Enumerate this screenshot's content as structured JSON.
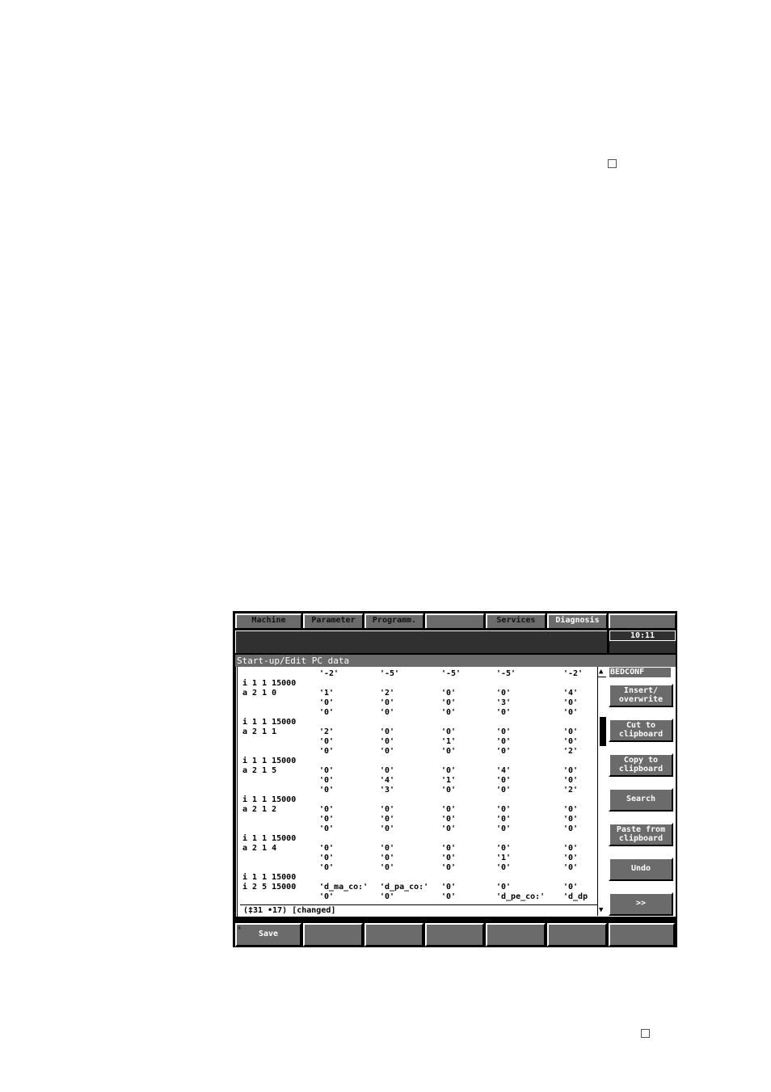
{
  "page_marks": [
    "small-square",
    "small-square"
  ],
  "tabs": [
    {
      "label": "Machine",
      "active": false
    },
    {
      "label": "Parameter",
      "active": false
    },
    {
      "label": "Programm.",
      "active": false
    },
    {
      "label": "",
      "active": false
    },
    {
      "label": "Services",
      "active": false
    },
    {
      "label": "Diagnosis",
      "active": true
    },
    {
      "label": "",
      "active": false
    }
  ],
  "clock": "10:11",
  "window_title": "Start-up/Edit PC data",
  "filename": "BEDCONF",
  "editor_lines": [
    {
      "label": "",
      "cells": [
        "'-2'",
        "'-5'",
        "'-5'",
        "'-5'",
        "'-2'"
      ]
    },
    {
      "label": "i 1 1 15000",
      "cells": []
    },
    {
      "label": "a 2 1 0",
      "cells": [
        "'1'",
        "'2'",
        "'0'",
        "'0'",
        "'4'"
      ]
    },
    {
      "label": "",
      "cells": [
        "'0'",
        "'0'",
        "'0'",
        "'3'",
        "'0'"
      ]
    },
    {
      "label": "",
      "cells": [
        "'0'",
        "'0'",
        "'0'",
        "'0'",
        "'0'"
      ]
    },
    {
      "label": "i 1 1 15000",
      "cells": []
    },
    {
      "label": "a 2 1 1",
      "cells": [
        "'2'",
        "'0'",
        "'0'",
        "'0'",
        "'0'"
      ]
    },
    {
      "label": "",
      "cells": [
        "'0'",
        "'0'",
        "'1'",
        "'0'",
        "'0'"
      ]
    },
    {
      "label": "",
      "cells": [
        "'0'",
        "'0'",
        "'0'",
        "'0'",
        "'2'"
      ]
    },
    {
      "label": "i 1 1 15000",
      "cells": []
    },
    {
      "label": "a 2 1 5",
      "cells": [
        "'0'",
        "'0'",
        "'0'",
        "'4'",
        "'0'"
      ]
    },
    {
      "label": "",
      "cells": [
        "'0'",
        "'4'",
        "'1'",
        "'0'",
        "'0'"
      ]
    },
    {
      "label": "",
      "cells": [
        "'0'",
        "'3'",
        "'0'",
        "'0'",
        "'2'"
      ]
    },
    {
      "label": "i 1 1 15000",
      "cells": []
    },
    {
      "label": "a 2 1 2",
      "cells": [
        "'0'",
        "'0'",
        "'0'",
        "'0'",
        "'0'"
      ]
    },
    {
      "label": "",
      "cells": [
        "'0'",
        "'0'",
        "'0'",
        "'0'",
        "'0'"
      ]
    },
    {
      "label": "",
      "cells": [
        "'0'",
        "'0'",
        "'0'",
        "'0'",
        "'0'"
      ]
    },
    {
      "label": "i 1 1 15000",
      "cells": []
    },
    {
      "label": "a 2 1 4",
      "cells": [
        "'0'",
        "'0'",
        "'0'",
        "'0'",
        "'0'"
      ]
    },
    {
      "label": "",
      "cells": [
        "'0'",
        "'0'",
        "'0'",
        "'1'",
        "'0'"
      ]
    },
    {
      "label": "",
      "cells": [
        "'0'",
        "'0'",
        "'0'",
        "'0'",
        "'0'"
      ]
    },
    {
      "label": "i 1 1 15000",
      "cells": []
    },
    {
      "label": "i 2 5 15000",
      "cells": [
        "'d_ma_co:'",
        "'d_pa_co:'",
        "'0'",
        "'0'",
        "'0'"
      ]
    },
    {
      "label": "",
      "cells": [
        "'0'",
        "'0'",
        "'0'",
        "'d_pe_co:'",
        "'d_dp"
      ]
    }
  ],
  "status_line": "(‡31 •17)  [changed]",
  "vertical_softkeys": [
    "Insert/\noverwrite",
    "Cut to\nclipboard",
    "Copy to\nclipboard",
    "Search",
    "Paste from\nclipboard",
    "Undo",
    ">>"
  ],
  "horizontal_softkeys": [
    "Save",
    "",
    "",
    "",
    "",
    "",
    ""
  ],
  "scroll": {
    "position_fraction": 0.2
  },
  "icons": {
    "scroll_up": "▲",
    "scroll_down": "▼",
    "recall": "▲"
  }
}
